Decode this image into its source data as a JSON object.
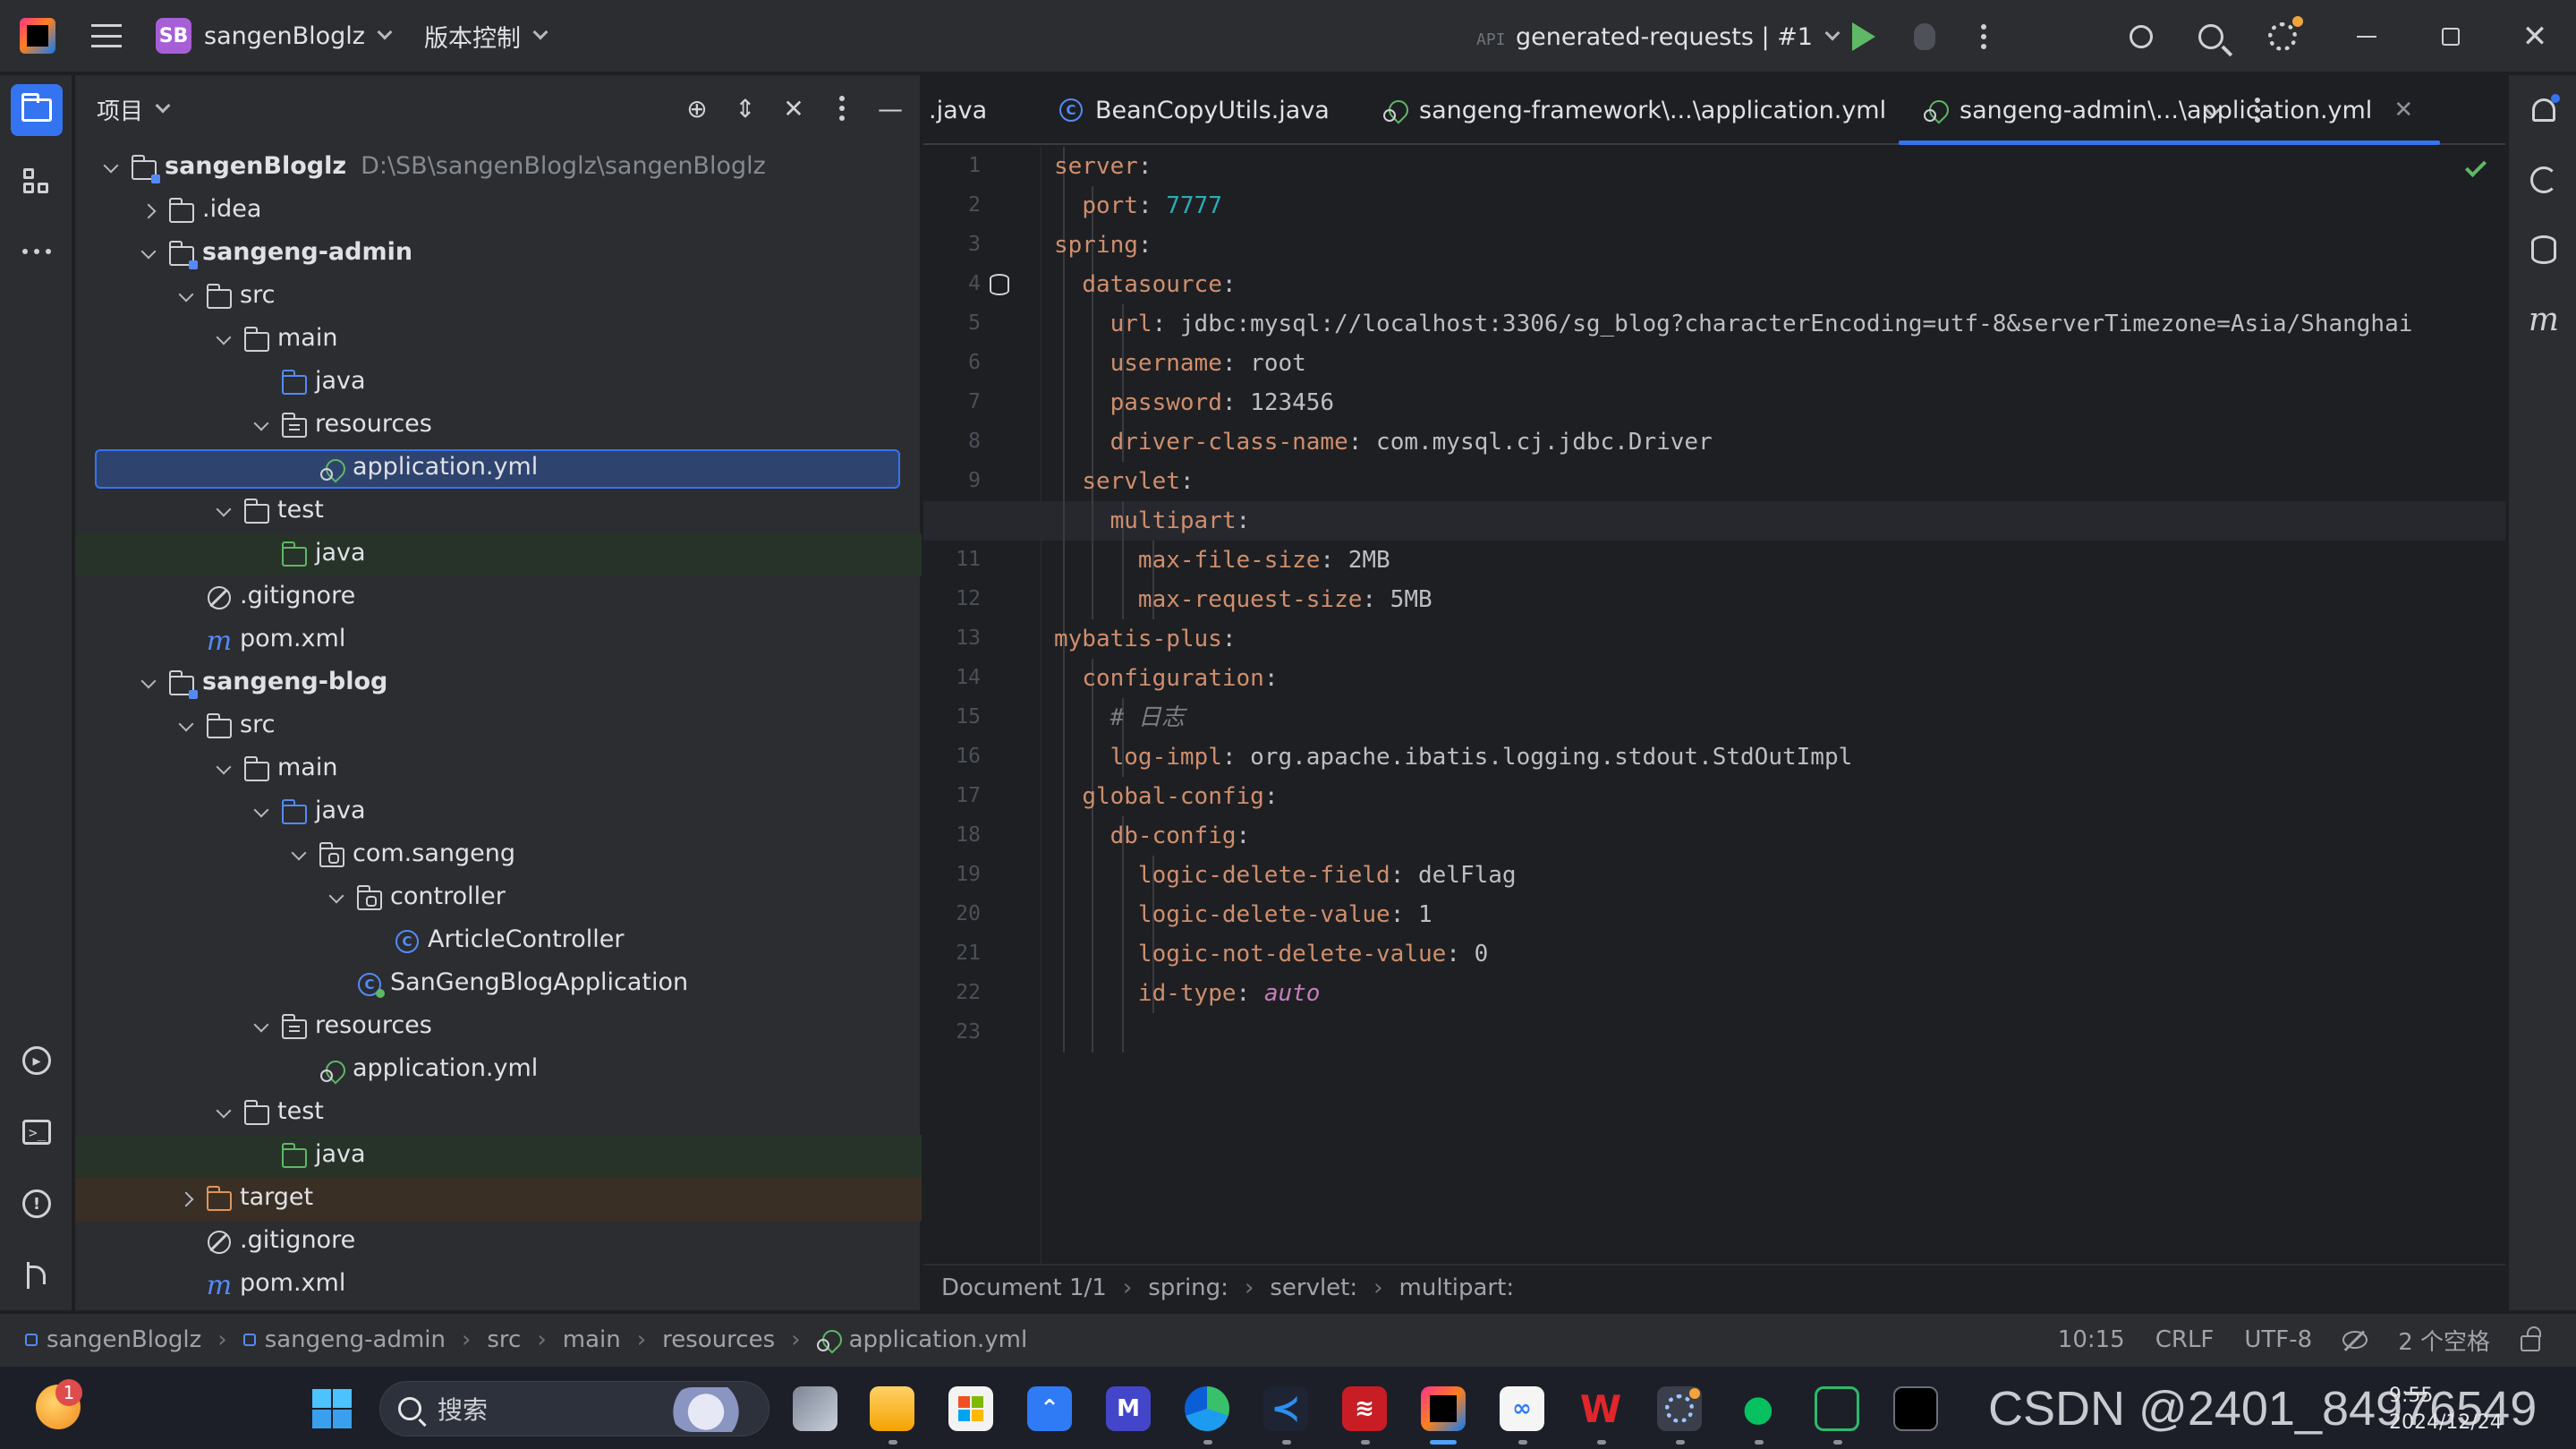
{
  "titlebar": {
    "project_badge": "SB",
    "project_name": "sangenBloglz",
    "vcs_label": "版本控制",
    "run_config": "generated-requests | #1"
  },
  "project_panel": {
    "title": "项目"
  },
  "tree": [
    {
      "label": "sangenBloglz",
      "path": "D:\\SB\\sangenBloglz\\sangenBloglz",
      "depth": 0,
      "arrow": "down",
      "icon": "module-folder-icon",
      "bold": true
    },
    {
      "label": ".idea",
      "depth": 1,
      "arrow": "right",
      "icon": "folder-icon"
    },
    {
      "label": "sangeng-admin",
      "depth": 1,
      "arrow": "down",
      "icon": "module-folder-icon",
      "bold": true
    },
    {
      "label": "src",
      "depth": 2,
      "arrow": "down",
      "icon": "folder-icon"
    },
    {
      "label": "main",
      "depth": 3,
      "arrow": "down",
      "icon": "folder-icon"
    },
    {
      "label": "java",
      "depth": 4,
      "arrow": "none",
      "icon": "source-folder-icon"
    },
    {
      "label": "resources",
      "depth": 4,
      "arrow": "down",
      "icon": "resources-folder-icon"
    },
    {
      "label": "application.yml",
      "depth": 5,
      "arrow": "none",
      "icon": "yaml-file-icon",
      "selected": true
    },
    {
      "label": "test",
      "depth": 3,
      "arrow": "down",
      "icon": "folder-icon"
    },
    {
      "label": "java",
      "depth": 4,
      "arrow": "none",
      "icon": "test-folder-icon",
      "highlight": "green"
    },
    {
      "label": ".gitignore",
      "depth": 2,
      "arrow": "none",
      "icon": "gitignore-icon"
    },
    {
      "label": "pom.xml",
      "depth": 2,
      "arrow": "none",
      "icon": "maven-icon"
    },
    {
      "label": "sangeng-blog",
      "depth": 1,
      "arrow": "down",
      "icon": "module-folder-icon",
      "bold": true
    },
    {
      "label": "src",
      "depth": 2,
      "arrow": "down",
      "icon": "folder-icon"
    },
    {
      "label": "main",
      "depth": 3,
      "arrow": "down",
      "icon": "folder-icon"
    },
    {
      "label": "java",
      "depth": 4,
      "arrow": "down",
      "icon": "source-folder-icon"
    },
    {
      "label": "com.sangeng",
      "depth": 5,
      "arrow": "down",
      "icon": "package-icon"
    },
    {
      "label": "controller",
      "depth": 6,
      "arrow": "down",
      "icon": "package-icon"
    },
    {
      "label": "ArticleController",
      "depth": 7,
      "arrow": "none",
      "icon": "class-icon"
    },
    {
      "label": "SanGengBlogApplication",
      "depth": 6,
      "arrow": "none",
      "icon": "spring-app-class-icon"
    },
    {
      "label": "resources",
      "depth": 4,
      "arrow": "down",
      "icon": "resources-folder-icon"
    },
    {
      "label": "application.yml",
      "depth": 5,
      "arrow": "none",
      "icon": "yaml-file-icon"
    },
    {
      "label": "test",
      "depth": 3,
      "arrow": "down",
      "icon": "folder-icon"
    },
    {
      "label": "java",
      "depth": 4,
      "arrow": "none",
      "icon": "test-folder-icon",
      "highlight": "green"
    },
    {
      "label": "target",
      "depth": 2,
      "arrow": "right",
      "icon": "excluded-folder-icon",
      "highlight": "orange"
    },
    {
      "label": ".gitignore",
      "depth": 2,
      "arrow": "none",
      "icon": "gitignore-icon"
    },
    {
      "label": "pom.xml",
      "depth": 2,
      "arrow": "none",
      "icon": "maven-icon"
    }
  ],
  "tabs": [
    {
      "label": ".java",
      "icon": "none"
    },
    {
      "label": "BeanCopyUtils.java",
      "icon": "class-icon"
    },
    {
      "label": "sangeng-framework\\...\\application.yml",
      "icon": "yaml-file-icon"
    },
    {
      "label": "sangeng-admin\\...\\application.yml",
      "icon": "yaml-file-icon",
      "active": true
    }
  ],
  "code_lines": [
    [
      {
        "t": "k",
        "s": "server"
      },
      {
        "t": "v",
        "s": ":"
      }
    ],
    [
      {
        "t": "v",
        "s": "  "
      },
      {
        "t": "k",
        "s": "port"
      },
      {
        "t": "v",
        "s": ": "
      },
      {
        "t": "n",
        "s": "7777"
      }
    ],
    [
      {
        "t": "k",
        "s": "spring"
      },
      {
        "t": "v",
        "s": ":"
      }
    ],
    [
      {
        "t": "v",
        "s": "  "
      },
      {
        "t": "k",
        "s": "datasource"
      },
      {
        "t": "v",
        "s": ":"
      }
    ],
    [
      {
        "t": "v",
        "s": "    "
      },
      {
        "t": "k",
        "s": "url"
      },
      {
        "t": "v",
        "s": ": jdbc:mysql://localhost:3306/sg_blog?characterEncoding=utf-8&serverTimezone=Asia/Shanghai"
      }
    ],
    [
      {
        "t": "v",
        "s": "    "
      },
      {
        "t": "k",
        "s": "username"
      },
      {
        "t": "v",
        "s": ": root"
      }
    ],
    [
      {
        "t": "v",
        "s": "    "
      },
      {
        "t": "k",
        "s": "password"
      },
      {
        "t": "v",
        "s": ": 123456"
      }
    ],
    [
      {
        "t": "v",
        "s": "    "
      },
      {
        "t": "k",
        "s": "driver-class-name"
      },
      {
        "t": "v",
        "s": ": com.mysql.cj.jdbc.Driver"
      }
    ],
    [
      {
        "t": "v",
        "s": "  "
      },
      {
        "t": "k",
        "s": "servlet"
      },
      {
        "t": "v",
        "s": ":"
      }
    ],
    [
      {
        "t": "v",
        "s": "    "
      },
      {
        "t": "k",
        "s": "multipart"
      },
      {
        "t": "v",
        "s": ":"
      }
    ],
    [
      {
        "t": "v",
        "s": "      "
      },
      {
        "t": "k",
        "s": "max-file-size"
      },
      {
        "t": "v",
        "s": ": 2MB"
      }
    ],
    [
      {
        "t": "v",
        "s": "      "
      },
      {
        "t": "k",
        "s": "max-request-size"
      },
      {
        "t": "v",
        "s": ": 5MB"
      }
    ],
    [
      {
        "t": "k",
        "s": "mybatis-plus"
      },
      {
        "t": "v",
        "s": ":"
      }
    ],
    [
      {
        "t": "v",
        "s": "  "
      },
      {
        "t": "k",
        "s": "configuration"
      },
      {
        "t": "v",
        "s": ":"
      }
    ],
    [
      {
        "t": "v",
        "s": "    "
      },
      {
        "t": "c",
        "s": "# 日志"
      }
    ],
    [
      {
        "t": "v",
        "s": "    "
      },
      {
        "t": "k",
        "s": "log-impl"
      },
      {
        "t": "v",
        "s": ": org.apache.ibatis.logging.stdout.StdOutImpl"
      }
    ],
    [
      {
        "t": "v",
        "s": "  "
      },
      {
        "t": "k",
        "s": "global-config"
      },
      {
        "t": "v",
        "s": ":"
      }
    ],
    [
      {
        "t": "v",
        "s": "    "
      },
      {
        "t": "k",
        "s": "db-config"
      },
      {
        "t": "v",
        "s": ":"
      }
    ],
    [
      {
        "t": "v",
        "s": "      "
      },
      {
        "t": "k",
        "s": "logic-delete-field"
      },
      {
        "t": "v",
        "s": ": delFlag"
      }
    ],
    [
      {
        "t": "v",
        "s": "      "
      },
      {
        "t": "k",
        "s": "logic-delete-value"
      },
      {
        "t": "v",
        "s": ": 1"
      }
    ],
    [
      {
        "t": "v",
        "s": "      "
      },
      {
        "t": "k",
        "s": "logic-not-delete-value"
      },
      {
        "t": "v",
        "s": ": 0"
      }
    ],
    [
      {
        "t": "v",
        "s": "      "
      },
      {
        "t": "k",
        "s": "id-type"
      },
      {
        "t": "v",
        "s": ": "
      },
      {
        "t": "a",
        "s": "auto"
      }
    ],
    []
  ],
  "current_line": 10,
  "breadcrumbs": [
    "Document 1/1",
    "spring:",
    "servlet:",
    "multipart:"
  ],
  "statusbar": {
    "path": [
      "sangenBloglz",
      "sangeng-admin",
      "src",
      "main",
      "resources",
      "application.yml"
    ],
    "position": "10:15",
    "line_sep": "CRLF",
    "encoding": "UTF-8",
    "indent": "2 个空格"
  },
  "taskbar": {
    "search_placeholder": "搜索",
    "badge_count": "1",
    "watermark": "CSDN @2401_84976549",
    "time": "9:55",
    "date": "2024/12/24"
  },
  "colors": {
    "accent": "#3574f0",
    "keyword": "#cf8e6d",
    "number": "#2aacb8",
    "green": "#5fb865"
  }
}
